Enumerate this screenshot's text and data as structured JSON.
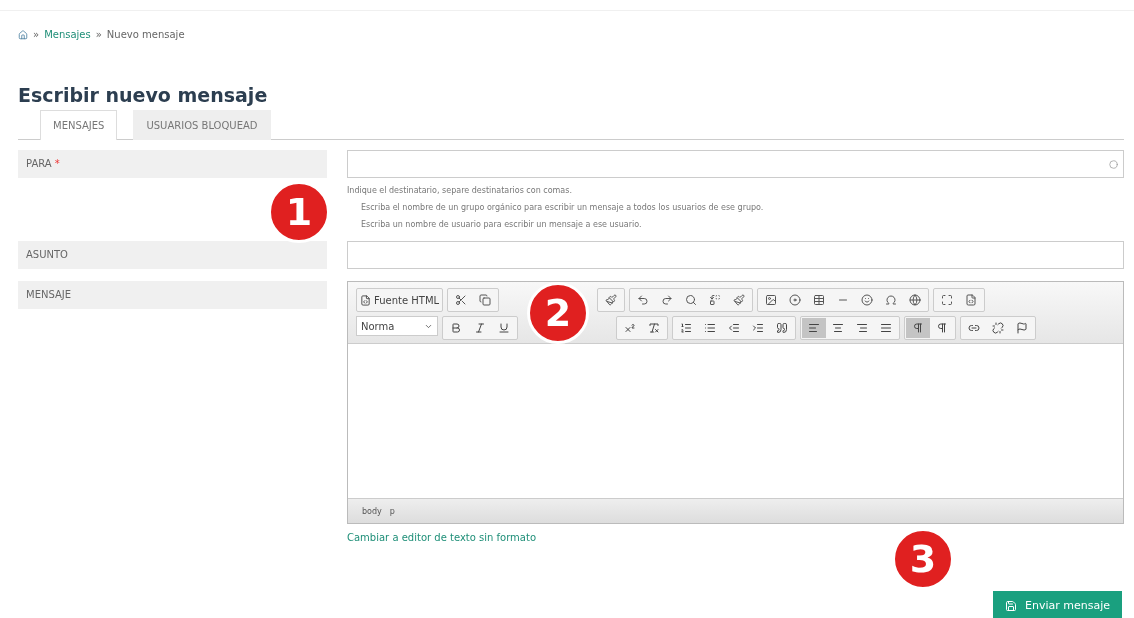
{
  "breadcrumb": {
    "links": [
      "Mensajes"
    ],
    "current": "Nuevo mensaje",
    "separator": "»"
  },
  "title": "Escribir nuevo mensaje",
  "tabs": [
    {
      "label": "MENSAJES",
      "selected": true
    },
    {
      "label": "USUARIOS BLOQUEAD",
      "selected": false
    }
  ],
  "fields": [
    {
      "label": "PARA",
      "required": true,
      "kind": "recipients",
      "help": "Indique el destinatario, separe destinatarios con comas.",
      "hints": [
        "Escriba el nombre de un grupo orgánico para escribir un mensaje a todos los usuarios de ese grupo.",
        "Escriba un nombre de usuario para escribir un mensaje a ese usuario."
      ]
    },
    {
      "label": "ASUNTO",
      "required": false,
      "kind": "text"
    },
    {
      "label": "MENSAJE",
      "required": false,
      "kind": "editor"
    }
  ],
  "editor": {
    "source_button": "Fuente HTML",
    "format": "Norma",
    "toolbar_row_2": [
      {
        "active": false
      },
      {
        "active": false
      },
      {
        "active": false
      },
      {
        "active": false
      },
      {
        "active": false
      },
      {
        "active": false
      },
      {
        "active": false
      },
      {
        "active": false
      },
      {
        "active": false
      },
      {
        "active": false
      },
      {
        "active": true
      },
      {
        "active": false
      },
      {
        "active": false
      },
      {
        "active": false
      },
      {
        "active": true
      },
      {
        "active": false
      },
      {
        "active": false
      },
      {
        "active": false
      },
      {
        "active": false
      }
    ],
    "path": [
      "body",
      "p"
    ]
  },
  "required_mark": "*",
  "switch_link": "Cambiar a editor de texto sin formato",
  "submit": "Enviar mensaje",
  "callouts": [
    "1",
    "2",
    "3"
  ]
}
